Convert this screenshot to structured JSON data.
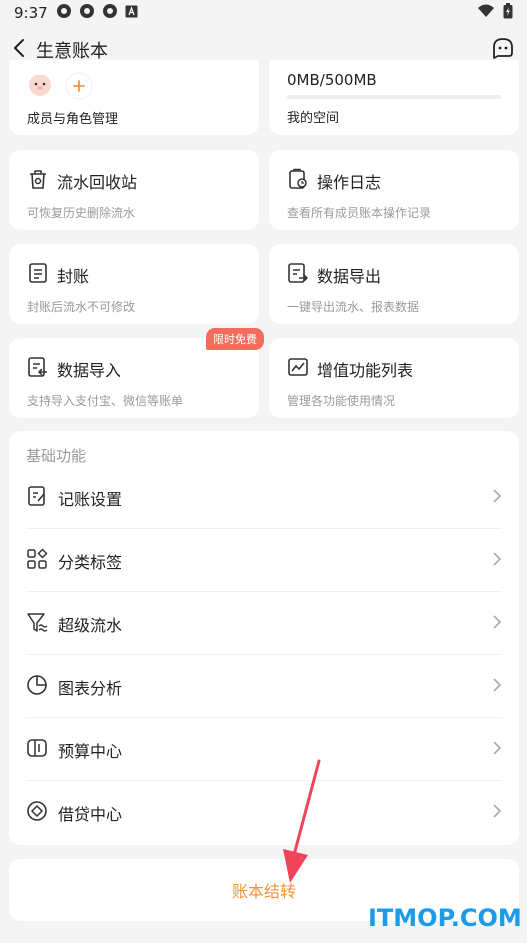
{
  "status_bar": {
    "time": "9:37"
  },
  "nav": {
    "title": "生意账本"
  },
  "top_cards": {
    "members": {
      "label": "成员与角色管理"
    },
    "storage": {
      "usage": "0MB/500MB",
      "label": "我的空间",
      "used_fraction": 0
    }
  },
  "tiles": [
    {
      "title": "流水回收站",
      "sub": "可恢复历史删除流水"
    },
    {
      "title": "操作日志",
      "sub": "查看所有成员账本操作记录"
    },
    {
      "title": "封账",
      "sub": "封账后流水不可修改"
    },
    {
      "title": "数据导出",
      "sub": "一键导出流水、报表数据"
    },
    {
      "title": "数据导入",
      "sub": "支持导入支付宝、微信等账单"
    },
    {
      "title": "增值功能列表",
      "sub": "管理各功能使用情况"
    }
  ],
  "badge": {
    "label": "限时免费"
  },
  "section": {
    "title": "基础功能",
    "items": [
      {
        "label": "记账设置"
      },
      {
        "label": "分类标签"
      },
      {
        "label": "超级流水"
      },
      {
        "label": "图表分析"
      },
      {
        "label": "预算中心"
      },
      {
        "label": "借贷中心"
      }
    ]
  },
  "transfer": {
    "label": "账本结转"
  },
  "watermark": {
    "text": "ITMOP.COM"
  },
  "colors": {
    "accent": "#f2943a",
    "badge": "#f26d5b",
    "watermark": "#1d9be8",
    "arrow": "#f0445a"
  }
}
